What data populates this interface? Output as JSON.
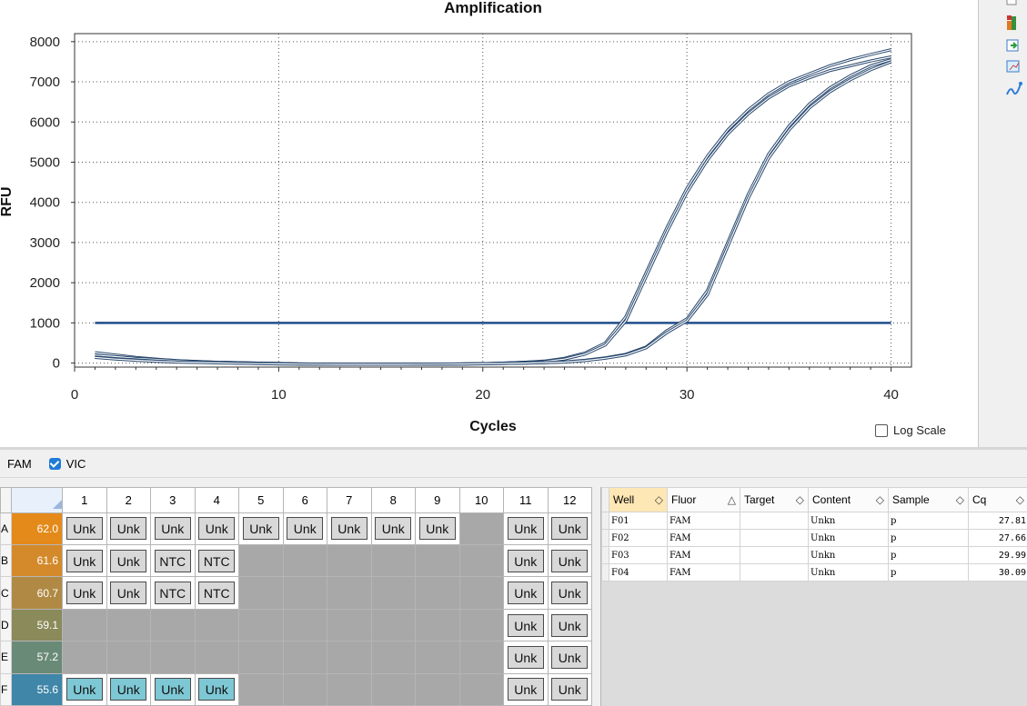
{
  "chart_data": {
    "type": "line",
    "title": "Amplification",
    "xlabel": "Cycles",
    "ylabel": "RFU",
    "xlim": [
      0,
      41
    ],
    "ylim": [
      -100,
      8200
    ],
    "xticks": [
      0,
      10,
      20,
      30,
      40
    ],
    "yticks": [
      0,
      1000,
      2000,
      3000,
      4000,
      5000,
      6000,
      7000,
      8000
    ],
    "grid": "dotted",
    "threshold": 1000,
    "curves_cq_approx": [
      27.8,
      27.7,
      30.0,
      30.1
    ],
    "x": [
      1,
      2,
      3,
      4,
      5,
      6,
      7,
      8,
      9,
      10,
      11,
      12,
      13,
      14,
      15,
      16,
      17,
      18,
      19,
      20,
      21,
      22,
      23,
      24,
      25,
      26,
      27,
      28,
      29,
      30,
      31,
      32,
      33,
      34,
      35,
      36,
      37,
      38,
      39,
      40
    ],
    "series": [
      {
        "values": [
          260,
          200,
          140,
          100,
          60,
          40,
          20,
          10,
          0,
          -10,
          -20,
          -25,
          -28,
          -30,
          -30,
          -30,
          -28,
          -25,
          -20,
          -15,
          0,
          20,
          50,
          120,
          250,
          500,
          1150,
          2250,
          3350,
          4350,
          5150,
          5800,
          6300,
          6700,
          7000,
          7200,
          7400,
          7550,
          7680,
          7800
        ]
      },
      {
        "values": [
          200,
          160,
          120,
          90,
          60,
          40,
          20,
          10,
          0,
          -10,
          -20,
          -25,
          -28,
          -30,
          -30,
          -30,
          -28,
          -25,
          -20,
          -15,
          0,
          20,
          40,
          100,
          220,
          450,
          1050,
          2150,
          3250,
          4250,
          5050,
          5700,
          6200,
          6600,
          6900,
          7100,
          7280,
          7400,
          7520,
          7620
        ]
      },
      {
        "values": [
          150,
          110,
          80,
          50,
          30,
          20,
          10,
          0,
          -10,
          -20,
          -25,
          -28,
          -30,
          -30,
          -30,
          -30,
          -28,
          -25,
          -22,
          -18,
          -10,
          0,
          10,
          30,
          70,
          130,
          220,
          400,
          800,
          1100,
          1800,
          3000,
          4200,
          5200,
          5900,
          6450,
          6850,
          7150,
          7400,
          7550
        ]
      },
      {
        "values": [
          140,
          100,
          70,
          45,
          25,
          15,
          5,
          -5,
          -15,
          -20,
          -25,
          -28,
          -30,
          -30,
          -30,
          -30,
          -28,
          -25,
          -22,
          -18,
          -10,
          0,
          10,
          25,
          60,
          120,
          200,
          380,
          750,
          1050,
          1700,
          2900,
          4100,
          5100,
          5800,
          6350,
          6750,
          7050,
          7300,
          7500
        ]
      }
    ]
  },
  "log_scale_label": "Log Scale",
  "fluors": [
    {
      "label": "FAM"
    },
    {
      "label": "VIC",
      "checked": true
    }
  ],
  "plate": {
    "columns": [
      "1",
      "2",
      "3",
      "4",
      "5",
      "6",
      "7",
      "8",
      "9",
      "10",
      "11",
      "12"
    ],
    "rows": [
      {
        "label": "A",
        "temp": "62.0",
        "tempColor": "#e48a1a",
        "wells": [
          "Unk",
          "Unk",
          "Unk",
          "Unk",
          "Unk",
          "Unk",
          "Unk",
          "Unk",
          "Unk",
          "",
          "Unk",
          "Unk"
        ],
        "blue": false
      },
      {
        "label": "B",
        "temp": "61.6",
        "tempColor": "#d48a2a",
        "wells": [
          "Unk",
          "Unk",
          "NTC",
          "NTC",
          "",
          "",
          "",
          "",
          "",
          "",
          "Unk",
          "Unk"
        ],
        "blue": false
      },
      {
        "label": "C",
        "temp": "60.7",
        "tempColor": "#b08a45",
        "wells": [
          "Unk",
          "Unk",
          "NTC",
          "NTC",
          "",
          "",
          "",
          "",
          "",
          "",
          "Unk",
          "Unk"
        ],
        "blue": false
      },
      {
        "label": "D",
        "temp": "59.1",
        "tempColor": "#8a8a5a",
        "wells": [
          "",
          "",
          "",
          "",
          "",
          "",
          "",
          "",
          "",
          "",
          "Unk",
          "Unk"
        ],
        "blue": false
      },
      {
        "label": "E",
        "temp": "57.2",
        "tempColor": "#6a8a78",
        "wells": [
          "",
          "",
          "",
          "",
          "",
          "",
          "",
          "",
          "",
          "",
          "Unk",
          "Unk"
        ],
        "blue": false
      },
      {
        "label": "F",
        "temp": "55.6",
        "tempColor": "#3f86a8",
        "wells": [
          "Unk",
          "Unk",
          "Unk",
          "Unk",
          "",
          "",
          "",
          "",
          "",
          "",
          "Unk",
          "Unk"
        ],
        "blue": true
      }
    ]
  },
  "results": {
    "headers": [
      "Well",
      "Fluor",
      "Target",
      "Content",
      "Sample",
      "Cq"
    ],
    "rows": [
      [
        "F01",
        "FAM",
        "",
        "Unkn",
        "p",
        "27.81"
      ],
      [
        "F02",
        "FAM",
        "",
        "Unkn",
        "p",
        "27.66"
      ],
      [
        "F03",
        "FAM",
        "",
        "Unkn",
        "p",
        "29.99"
      ],
      [
        "F04",
        "FAM",
        "",
        "Unkn",
        "p",
        "30.09"
      ]
    ]
  }
}
